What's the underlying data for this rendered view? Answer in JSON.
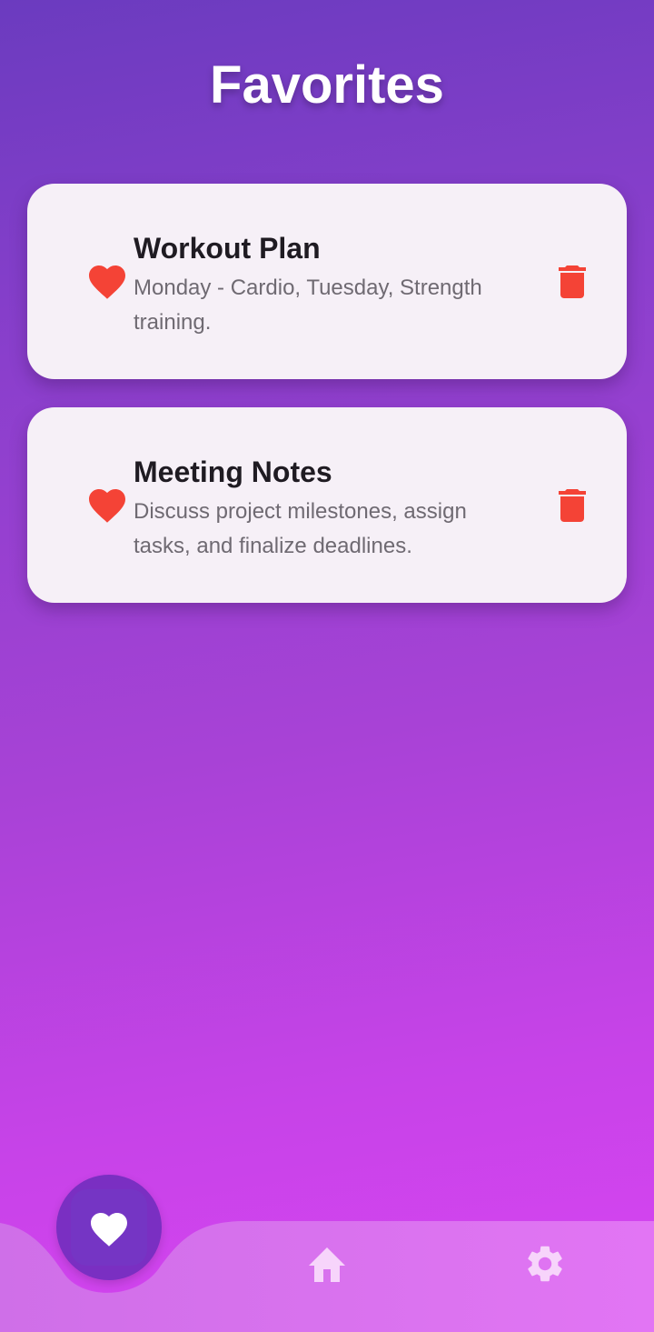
{
  "header": {
    "title": "Favorites"
  },
  "favorites": [
    {
      "title": "Workout Plan",
      "description": "Monday - Cardio, Tuesday, Strength training.",
      "icon": "heart-icon",
      "action_icon": "trash-icon"
    },
    {
      "title": "Meeting Notes",
      "description": "Discuss project milestones, assign tasks, and finalize deadlines.",
      "icon": "heart-icon",
      "action_icon": "trash-icon"
    }
  ],
  "bottom_nav": {
    "items": [
      {
        "icon": "heart-icon",
        "active": true
      },
      {
        "icon": "home-icon",
        "active": false
      },
      {
        "icon": "settings-icon",
        "active": false
      }
    ]
  },
  "colors": {
    "gradient_start": "#6b3bbf",
    "gradient_end": "#d844f2",
    "card_background": "#f6f0f7",
    "accent_red": "#f44336",
    "nav_bar": "#d878ee",
    "nav_active_bubble": "#7a2fc2",
    "nav_icon": "#f7d4fb"
  }
}
